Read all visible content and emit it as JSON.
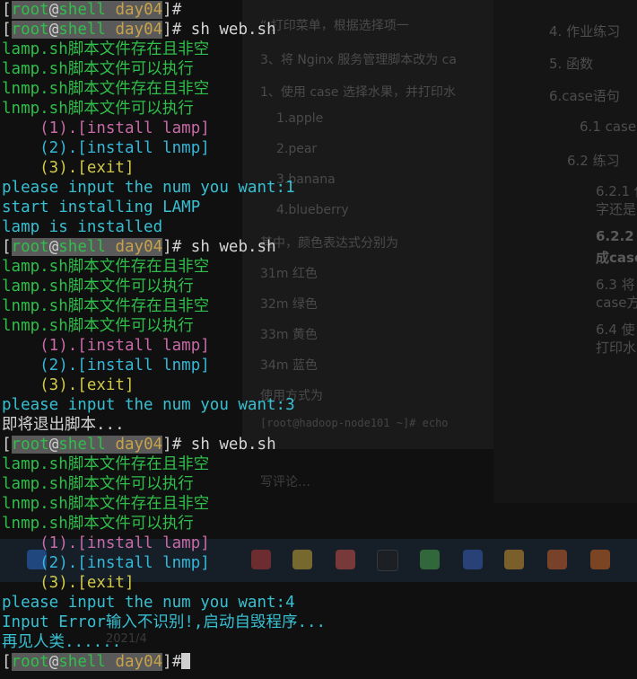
{
  "background_document": {
    "lines": [
      "“ 打印菜单，根据选择项一",
      "3、将 Nginx 服务管理脚本改为 ca",
      "1、使用 case 选择水果，并打印水",
      "1.apple",
      "2.pear",
      "3.banana",
      "4.blueberry",
      "其中，颜色表达式分别为",
      "31m 红色",
      "32m 绿色",
      "33m 黄色",
      "34m 蓝色",
      "使用方式为",
      "[root@hadoop-node101 ~]# echo"
    ],
    "toc": [
      "4. 作业练习",
      "5. 函数",
      "6.case语句",
      "6.1 case",
      "6.2 练习",
      "6.2.1 使",
      "字还是",
      "6.2.2 ",
      "成case",
      "6.3 将",
      "case方",
      "6.4 使",
      "打印水"
    ],
    "comment_box": "写评论…",
    "clock": "2021/4"
  },
  "prompt": {
    "open_bracket": "[",
    "user": "root",
    "at": "@",
    "host": "shell",
    "dir": "day04",
    "close": "]#"
  },
  "terminal_lines": [
    {
      "kind": "prompt",
      "cmd": ""
    },
    {
      "kind": "prompt",
      "cmd": " sh web.sh"
    },
    {
      "kind": "green",
      "text": "lamp.sh脚本文件存在且非空"
    },
    {
      "kind": "green",
      "text": "lamp.sh脚本文件可以执行"
    },
    {
      "kind": "green",
      "text": "lnmp.sh脚本文件存在且非空"
    },
    {
      "kind": "green",
      "text": "lnmp.sh脚本文件可以执行"
    },
    {
      "kind": "menu1",
      "text": "    (1).[install lamp]"
    },
    {
      "kind": "menu2",
      "text": "    (2).[install lnmp]"
    },
    {
      "kind": "menu3",
      "text": "    (3).[exit]"
    },
    {
      "kind": "cyan",
      "text": "please input the num you want:1"
    },
    {
      "kind": "cyan",
      "text": "start installing LAMP"
    },
    {
      "kind": "cyan",
      "text": "lamp is installed"
    },
    {
      "kind": "prompt",
      "cmd": " sh web.sh"
    },
    {
      "kind": "green",
      "text": "lamp.sh脚本文件存在且非空"
    },
    {
      "kind": "green",
      "text": "lamp.sh脚本文件可以执行"
    },
    {
      "kind": "green",
      "text": "lnmp.sh脚本文件存在且非空"
    },
    {
      "kind": "green",
      "text": "lnmp.sh脚本文件可以执行"
    },
    {
      "kind": "menu1",
      "text": "    (1).[install lamp]"
    },
    {
      "kind": "menu2",
      "text": "    (2).[install lnmp]"
    },
    {
      "kind": "menu3",
      "text": "    (3).[exit]"
    },
    {
      "kind": "cyan",
      "text": "please input the num you want:3"
    },
    {
      "kind": "white",
      "text": "即将退出脚本..."
    },
    {
      "kind": "prompt",
      "cmd": " sh web.sh"
    },
    {
      "kind": "green",
      "text": "lamp.sh脚本文件存在且非空"
    },
    {
      "kind": "green",
      "text": "lamp.sh脚本文件可以执行"
    },
    {
      "kind": "green",
      "text": "lnmp.sh脚本文件存在且非空"
    },
    {
      "kind": "green",
      "text": "lnmp.sh脚本文件可以执行"
    },
    {
      "kind": "menu1",
      "text": "    (1).[install lamp]"
    },
    {
      "kind": "menu2",
      "text": "    (2).[install lnmp]"
    },
    {
      "kind": "menu3",
      "text": "    (3).[exit]"
    },
    {
      "kind": "cyan",
      "text": "please input the num you want:4"
    },
    {
      "kind": "cyan",
      "text": "Input Error输入不识别!,启动自毁程序..."
    },
    {
      "kind": "cyan",
      "text": "再见人类......"
    },
    {
      "kind": "prompt",
      "cmd": "",
      "cursor": true
    }
  ],
  "colors": {
    "green": "#2fbf4a",
    "cyan": "#37c0d2",
    "magenta": "#c86aa6",
    "blue": "#35b8d8",
    "yellow": "#d1c94a",
    "prompt_dir": "#c8a24a",
    "prompt_bg": "#5a5a5a"
  }
}
